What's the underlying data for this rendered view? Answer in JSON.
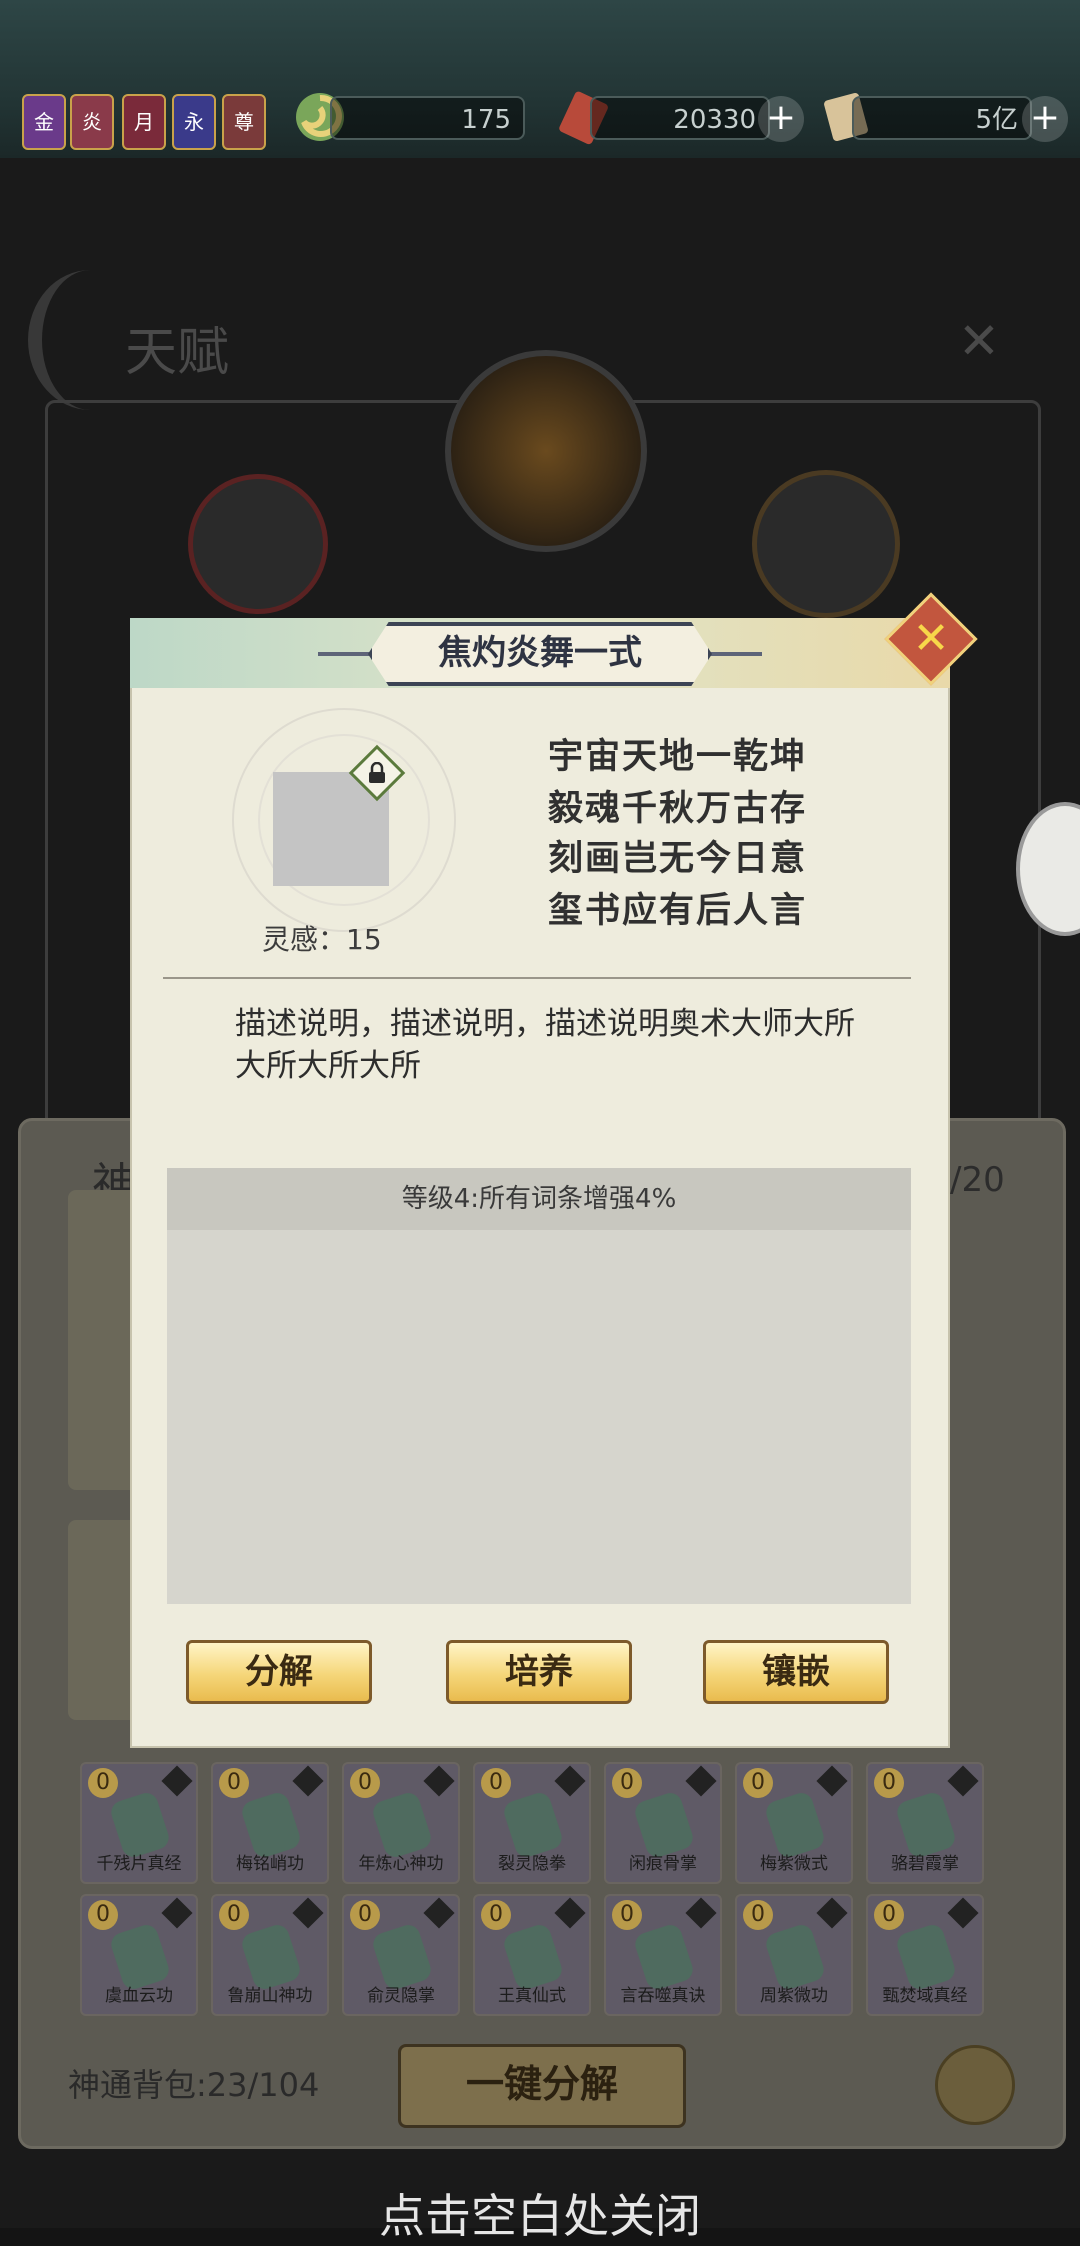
{
  "topbar": {
    "badges": [
      "金",
      "炎",
      "月",
      "永",
      "尊"
    ],
    "resource1": {
      "value": "175",
      "icon": "jade-swirl-icon"
    },
    "resource2": {
      "value": "20330",
      "icon": "red-book-icon",
      "plus": "+"
    },
    "resource3": {
      "value": "5亿",
      "icon": "scroll-icon",
      "plus": "+"
    }
  },
  "background": {
    "title": "天赋",
    "close": "✕",
    "panel_side_text": "神",
    "panel_count": "/20",
    "bag_label": "神通背包:23/104",
    "decompose_all": "一键分解",
    "close_hint": "点击空白处关闭",
    "cards_row1": [
      {
        "count": "0",
        "name": "千残片真经"
      },
      {
        "count": "0",
        "name": "梅铭峭功"
      },
      {
        "count": "0",
        "name": "年炼心神功"
      },
      {
        "count": "0",
        "name": "裂灵隐拳"
      },
      {
        "count": "0",
        "name": "闲痕骨掌"
      },
      {
        "count": "0",
        "name": "梅紫微式"
      },
      {
        "count": "0",
        "name": "骆碧霞掌"
      }
    ],
    "cards_row2": [
      {
        "count": "0",
        "name": "虞血云功"
      },
      {
        "count": "0",
        "name": "鲁崩山神功"
      },
      {
        "count": "0",
        "name": "俞灵隐掌"
      },
      {
        "count": "0",
        "name": "王真仙式"
      },
      {
        "count": "0",
        "name": "言吞噬真诀"
      },
      {
        "count": "0",
        "name": "周紫微功"
      },
      {
        "count": "0",
        "name": "甄焚域真经"
      }
    ]
  },
  "popup": {
    "title": "焦灼炎舞一式",
    "close": "✕",
    "inspiration": "灵感：15",
    "poem": [
      "宇宙天地一乾坤",
      "毅魂千秋万古存",
      "刻画岂无今日意",
      "玺书应有后人言"
    ],
    "description": "描述说明，描述说明，描述说明奥术大师大所大所大所大所",
    "effect_header": "等级4:所有词条增强4%",
    "buttons": {
      "decompose": "分解",
      "cultivate": "培养",
      "inlay": "镶嵌"
    }
  },
  "colors": {
    "accent_gold": "#f5d679",
    "close_red": "#c2563e",
    "popup_bg": "#eeecdd"
  }
}
